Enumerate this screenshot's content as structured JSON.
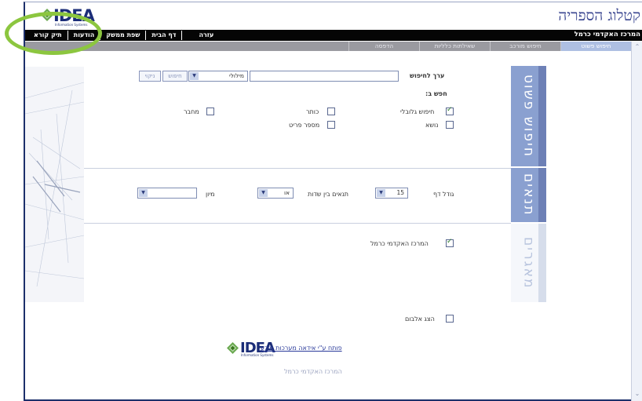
{
  "brand": {
    "logo_text": "IDEA",
    "logo_subtext": "Information Systems",
    "app_title": "קטלוג הספריה",
    "organization": "המרכז האקדמי כרמל"
  },
  "top_menu": [
    "תיק קורא",
    "הודעות",
    "שפת ממשק",
    "דף הבית",
    "עזרה"
  ],
  "tabs": [
    {
      "label": "חיפוש פשוט",
      "active": true
    },
    {
      "label": "חיפוש מורכב",
      "active": false
    },
    {
      "label": "שאילתות כלליות",
      "active": false
    },
    {
      "label": "הדפסה",
      "active": false
    }
  ],
  "side_tabs": {
    "simple_search": "חיפוש פשוט",
    "conditions": "תנאים",
    "repositories": "מאגרים"
  },
  "search": {
    "value_label": "ערך לחיפוש",
    "value": "",
    "search_by_label": "חפש ב:",
    "match_select": "מילולי",
    "search_button": "חיפוש",
    "clear_button": "ניקוי",
    "fields": [
      {
        "label": "חיפוש גלובלי",
        "checked": true
      },
      {
        "label": "כותר",
        "checked": false
      },
      {
        "label": "מחבר",
        "checked": false
      },
      {
        "label": "נושא",
        "checked": false
      },
      {
        "label": "מספר פריט",
        "checked": false
      }
    ]
  },
  "conditions": {
    "page_size_label": "גודל דף",
    "page_size_value": "15",
    "field_condition_label": "תנאים בין שדות",
    "field_condition_value": "או",
    "sort_label": "מיון",
    "sort_value": ""
  },
  "repositories": {
    "items": [
      {
        "label": "המרכז האקדמי כרמל",
        "checked": true
      }
    ]
  },
  "album": {
    "label": "הצג אלבום",
    "checked": false
  },
  "footer": {
    "powered_by": "פותח ע\"י אידאה מערכות מידע",
    "org": "המרכז האקדמי כרמל"
  },
  "colors": {
    "brand_navy": "#1b2d78",
    "tab_active": "#aebfe2",
    "side_tab": "#8aa0d0",
    "highlight": "#8cc63f"
  }
}
